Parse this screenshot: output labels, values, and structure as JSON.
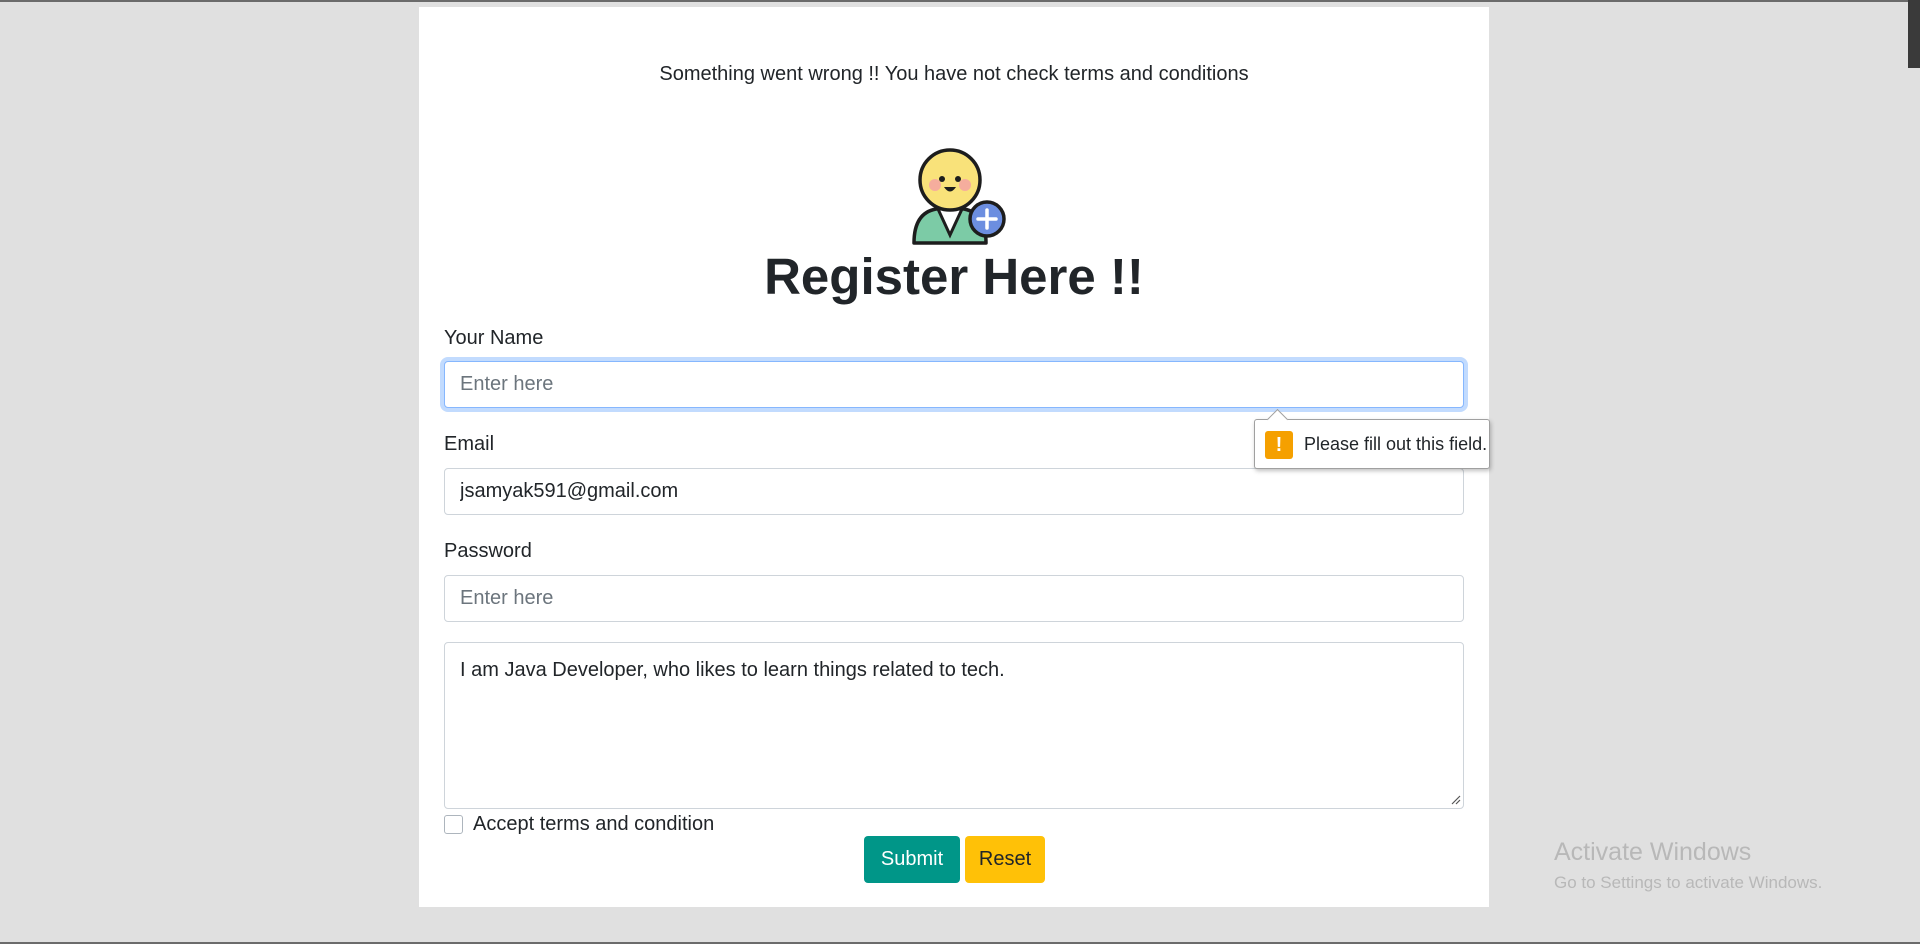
{
  "alert": {
    "message": "Something went wrong !! You have not check terms and conditions"
  },
  "header": {
    "title": "Register Here !!",
    "avatar_icon": "user-add-icon"
  },
  "form": {
    "name": {
      "label": "Your Name",
      "placeholder": "Enter here",
      "value": ""
    },
    "email": {
      "label": "Email",
      "placeholder": "Enter here",
      "value": "jsamyak591@gmail.com"
    },
    "password": {
      "label": "Password",
      "placeholder": "Enter here",
      "value": ""
    },
    "about": {
      "value": "I am Java Developer, who likes to learn things related to tech."
    },
    "terms": {
      "label": "Accept terms and condition",
      "checked": false
    },
    "submit_label": "Submit",
    "reset_label": "Reset"
  },
  "validation_tooltip": {
    "text": "Please fill out this field.",
    "icon": "warning-icon",
    "icon_glyph": "!"
  },
  "os_watermark": {
    "title": "Activate Windows",
    "subtitle": "Go to Settings to activate Windows."
  },
  "colors": {
    "submit": "#009688",
    "reset": "#ffc107",
    "warning": "#f5a000",
    "focus_border": "#86b7fe"
  }
}
